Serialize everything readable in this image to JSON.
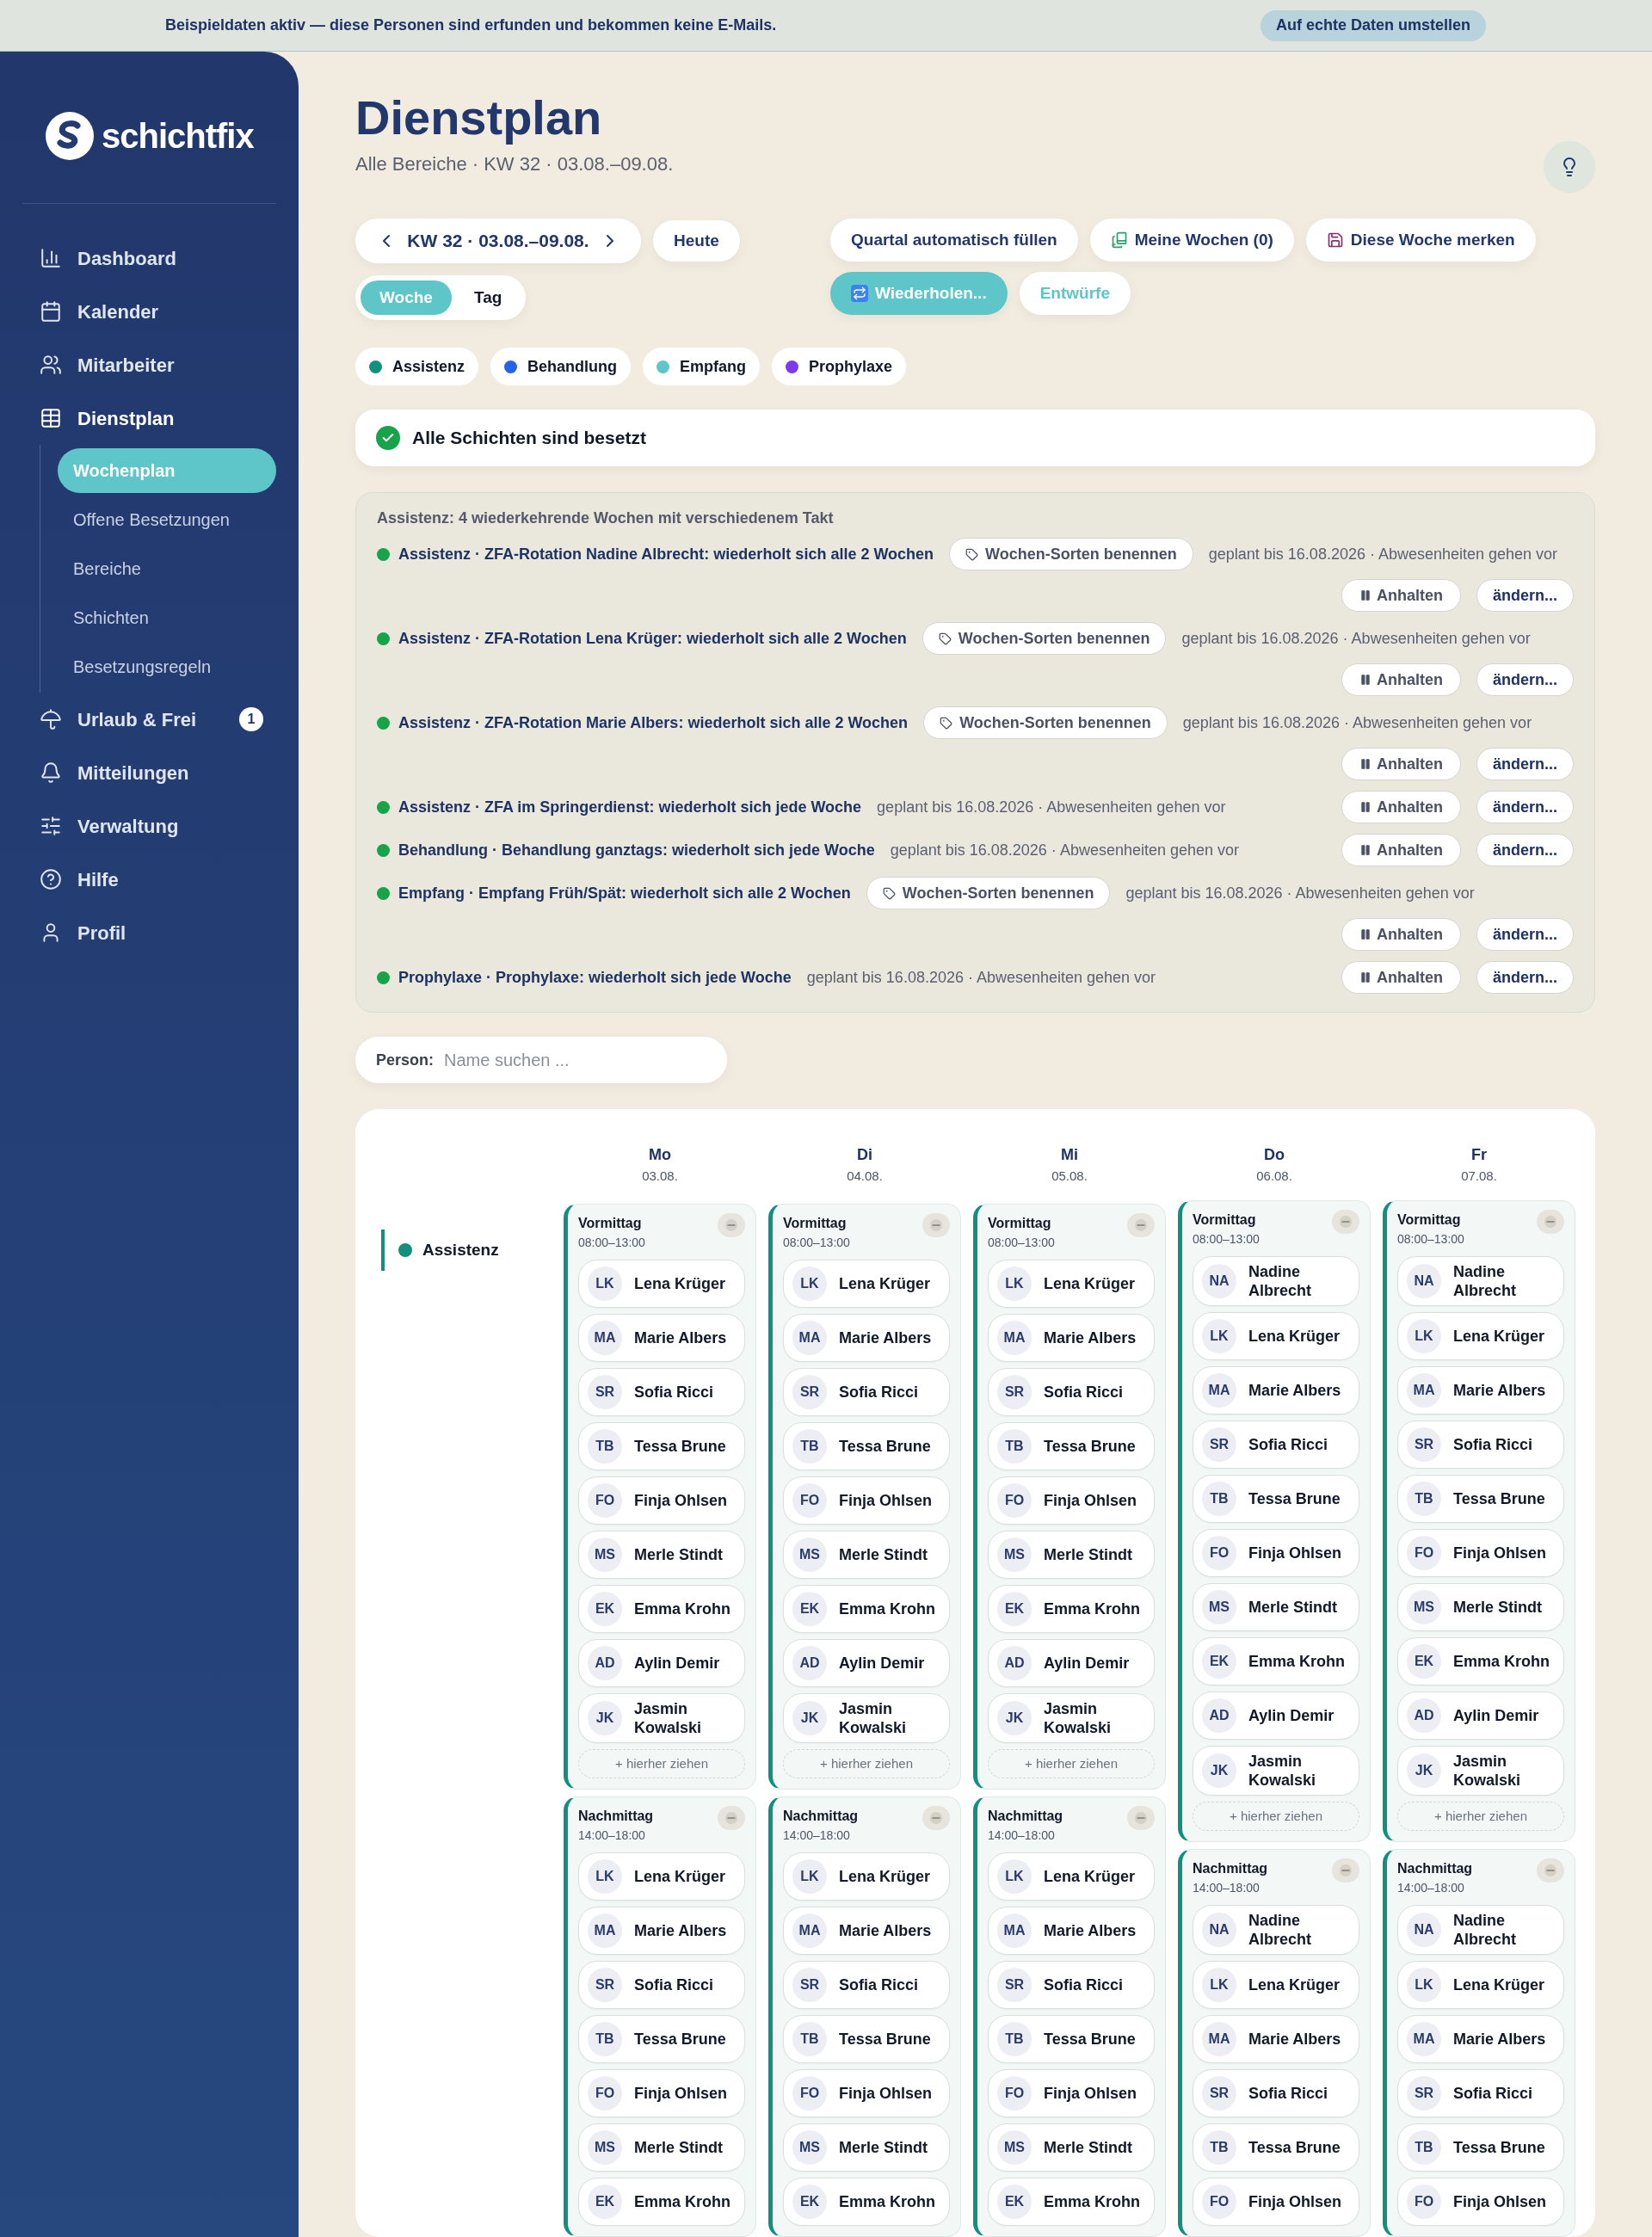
{
  "banner": {
    "text": "Beispieldaten aktiv — diese Personen sind erfunden und bekommen keine E-Mails.",
    "button": "Auf echte Daten umstellen"
  },
  "sidebar": {
    "logo": "schichtfix",
    "items": [
      {
        "label": "Dashboard",
        "selected": false
      },
      {
        "label": "Kalender",
        "selected": false
      },
      {
        "label": "Mitarbeiter",
        "selected": false
      },
      {
        "label": "Dienstplan",
        "selected": true,
        "children": [
          {
            "label": "Wochenplan",
            "selected": true
          },
          {
            "label": "Offene Besetzungen",
            "selected": false
          },
          {
            "label": "Bereiche",
            "selected": false
          },
          {
            "label": "Schichten",
            "selected": false
          },
          {
            "label": "Besetzungsregeln",
            "selected": false
          }
        ]
      },
      {
        "label": "Urlaub & Frei",
        "selected": false,
        "badge": "1"
      },
      {
        "label": "Mitteilungen",
        "selected": false
      },
      {
        "label": "Verwaltung",
        "selected": false
      },
      {
        "label": "Hilfe",
        "selected": false
      },
      {
        "label": "Profil",
        "selected": false
      }
    ]
  },
  "header": {
    "title": "Dienstplan",
    "subtitle": "Alle Bereiche · KW 32 · 03.08.–09.08."
  },
  "week_nav": {
    "label": "KW 32 · 03.08.–09.08.",
    "today": "Heute"
  },
  "view_toggle": [
    {
      "label": "Woche",
      "selected": true
    },
    {
      "label": "Tag",
      "selected": false
    }
  ],
  "actions": [
    {
      "label": "Quartal automatisch füllen",
      "kind": "plain",
      "active": false
    },
    {
      "label": "Meine Wochen (0)",
      "kind": "books",
      "active": false
    },
    {
      "label": "Diese Woche merken",
      "kind": "save",
      "active": false
    },
    {
      "label": "Wiederholen...",
      "kind": "repeat",
      "active": true
    },
    {
      "label": "Entwürfe",
      "kind": "accent",
      "active": false
    }
  ],
  "legend": [
    {
      "label": "Assistenz",
      "color": "#12907f"
    },
    {
      "label": "Behandlung",
      "color": "#2563eb"
    },
    {
      "label": "Empfang",
      "color": "#5ec6c8"
    },
    {
      "label": "Prophylaxe",
      "color": "#7c3aed"
    }
  ],
  "status": {
    "text": "Alle Schichten sind besetzt",
    "ok": true
  },
  "recurrences": {
    "title": "Assistenz: 4 wiederkehrende Wochen mit verschiedenem Takt",
    "items": [
      {
        "title": "Assistenz · ZFA-Rotation Nadine Albrecht: wiederholt sich alle 2 Wochen",
        "name_button": "Wochen-Sorten benennen",
        "note": "geplant bis 16.08.2026 · Abwesenheiten gehen vor",
        "pause": "Anhalten",
        "edit": "ändern..."
      },
      {
        "title": "Assistenz · ZFA-Rotation Lena Krüger: wiederholt sich alle 2 Wochen",
        "name_button": "Wochen-Sorten benennen",
        "note": "geplant bis 16.08.2026 · Abwesenheiten gehen vor",
        "pause": "Anhalten",
        "edit": "ändern..."
      },
      {
        "title": "Assistenz · ZFA-Rotation Marie Albers: wiederholt sich alle 2 Wochen",
        "name_button": "Wochen-Sorten benennen",
        "note": "geplant bis 16.08.2026 · Abwesenheiten gehen vor",
        "pause": "Anhalten",
        "edit": "ändern..."
      },
      {
        "title": "Assistenz · ZFA im Springerdienst: wiederholt sich jede Woche",
        "note": "geplant bis 16.08.2026 · Abwesenheiten gehen vor",
        "pause": "Anhalten",
        "edit": "ändern..."
      },
      {
        "title": "Behandlung · Behandlung ganztags: wiederholt sich jede Woche",
        "note": "geplant bis 16.08.2026 · Abwesenheiten gehen vor",
        "pause": "Anhalten",
        "edit": "ändern..."
      },
      {
        "title": "Empfang · Empfang Früh/Spät: wiederholt sich alle 2 Wochen",
        "name_button": "Wochen-Sorten benennen",
        "note": "geplant bis 16.08.2026 · Abwesenheiten gehen vor",
        "pause": "Anhalten",
        "edit": "ändern..."
      },
      {
        "title": "Prophylaxe · Prophylaxe: wiederholt sich jede Woche",
        "note": "geplant bis 16.08.2026 · Abwesenheiten gehen vor",
        "pause": "Anhalten",
        "edit": "ändern..."
      }
    ]
  },
  "search": {
    "label": "Person:",
    "placeholder": "Name suchen ..."
  },
  "schedule": {
    "days": [
      {
        "name": "Mo",
        "date": "03.08."
      },
      {
        "name": "Di",
        "date": "04.08."
      },
      {
        "name": "Mi",
        "date": "05.08."
      },
      {
        "name": "Do",
        "date": "06.08."
      },
      {
        "name": "Fr",
        "date": "07.08."
      }
    ],
    "area": {
      "name": "Assistenz",
      "color": "#12907f"
    },
    "columns": [
      {
        "shifts": [
          {
            "name": "Vormittag",
            "time": "08:00–13:00",
            "people": [
              [
                "LK",
                "Lena Krüger"
              ],
              [
                "MA",
                "Marie Albers"
              ],
              [
                "SR",
                "Sofia Ricci"
              ],
              [
                "TB",
                "Tessa Brune"
              ],
              [
                "FO",
                "Finja Ohlsen"
              ],
              [
                "MS",
                "Merle Stindt"
              ],
              [
                "EK",
                "Emma Krohn"
              ],
              [
                "AD",
                "Aylin Demir"
              ],
              [
                "JK",
                "Jasmin Kowalski"
              ]
            ],
            "drop_hint": "+ hierher ziehen"
          },
          {
            "name": "Nachmittag",
            "time": "14:00–18:00",
            "people": [
              [
                "LK",
                "Lena Krüger"
              ],
              [
                "MA",
                "Marie Albers"
              ],
              [
                "SR",
                "Sofia Ricci"
              ],
              [
                "TB",
                "Tessa Brune"
              ],
              [
                "FO",
                "Finja Ohlsen"
              ],
              [
                "MS",
                "Merle Stindt"
              ],
              [
                "EK",
                "Emma Krohn"
              ]
            ]
          }
        ]
      },
      {
        "shifts": [
          {
            "name": "Vormittag",
            "time": "08:00–13:00",
            "people": [
              [
                "LK",
                "Lena Krüger"
              ],
              [
                "MA",
                "Marie Albers"
              ],
              [
                "SR",
                "Sofia Ricci"
              ],
              [
                "TB",
                "Tessa Brune"
              ],
              [
                "FO",
                "Finja Ohlsen"
              ],
              [
                "MS",
                "Merle Stindt"
              ],
              [
                "EK",
                "Emma Krohn"
              ],
              [
                "AD",
                "Aylin Demir"
              ],
              [
                "JK",
                "Jasmin Kowalski"
              ]
            ],
            "drop_hint": "+ hierher ziehen"
          },
          {
            "name": "Nachmittag",
            "time": "14:00–18:00",
            "people": [
              [
                "LK",
                "Lena Krüger"
              ],
              [
                "MA",
                "Marie Albers"
              ],
              [
                "SR",
                "Sofia Ricci"
              ],
              [
                "TB",
                "Tessa Brune"
              ],
              [
                "FO",
                "Finja Ohlsen"
              ],
              [
                "MS",
                "Merle Stindt"
              ],
              [
                "EK",
                "Emma Krohn"
              ]
            ]
          }
        ]
      },
      {
        "shifts": [
          {
            "name": "Vormittag",
            "time": "08:00–13:00",
            "people": [
              [
                "LK",
                "Lena Krüger"
              ],
              [
                "MA",
                "Marie Albers"
              ],
              [
                "SR",
                "Sofia Ricci"
              ],
              [
                "TB",
                "Tessa Brune"
              ],
              [
                "FO",
                "Finja Ohlsen"
              ],
              [
                "MS",
                "Merle Stindt"
              ],
              [
                "EK",
                "Emma Krohn"
              ],
              [
                "AD",
                "Aylin Demir"
              ],
              [
                "JK",
                "Jasmin Kowalski"
              ]
            ],
            "drop_hint": "+ hierher ziehen"
          },
          {
            "name": "Nachmittag",
            "time": "14:00–18:00",
            "people": [
              [
                "LK",
                "Lena Krüger"
              ],
              [
                "MA",
                "Marie Albers"
              ],
              [
                "SR",
                "Sofia Ricci"
              ],
              [
                "TB",
                "Tessa Brune"
              ],
              [
                "FO",
                "Finja Ohlsen"
              ],
              [
                "MS",
                "Merle Stindt"
              ],
              [
                "EK",
                "Emma Krohn"
              ]
            ]
          }
        ]
      },
      {
        "shifts": [
          {
            "name": "Vormittag",
            "time": "08:00–13:00",
            "people": [
              [
                "NA",
                "Nadine Albrecht"
              ],
              [
                "LK",
                "Lena Krüger"
              ],
              [
                "MA",
                "Marie Albers"
              ],
              [
                "SR",
                "Sofia Ricci"
              ],
              [
                "TB",
                "Tessa Brune"
              ],
              [
                "FO",
                "Finja Ohlsen"
              ],
              [
                "MS",
                "Merle Stindt"
              ],
              [
                "EK",
                "Emma Krohn"
              ],
              [
                "AD",
                "Aylin Demir"
              ],
              [
                "JK",
                "Jasmin Kowalski"
              ]
            ],
            "drop_hint": "+ hierher ziehen"
          },
          {
            "name": "Nachmittag",
            "time": "14:00–18:00",
            "people": [
              [
                "NA",
                "Nadine Albrecht"
              ],
              [
                "LK",
                "Lena Krüger"
              ],
              [
                "MA",
                "Marie Albers"
              ],
              [
                "SR",
                "Sofia Ricci"
              ],
              [
                "TB",
                "Tessa Brune"
              ],
              [
                "FO",
                "Finja Ohlsen"
              ]
            ]
          }
        ]
      },
      {
        "shifts": [
          {
            "name": "Vormittag",
            "time": "08:00–13:00",
            "people": [
              [
                "NA",
                "Nadine Albrecht"
              ],
              [
                "LK",
                "Lena Krüger"
              ],
              [
                "MA",
                "Marie Albers"
              ],
              [
                "SR",
                "Sofia Ricci"
              ],
              [
                "TB",
                "Tessa Brune"
              ],
              [
                "FO",
                "Finja Ohlsen"
              ],
              [
                "MS",
                "Merle Stindt"
              ],
              [
                "EK",
                "Emma Krohn"
              ],
              [
                "AD",
                "Aylin Demir"
              ],
              [
                "JK",
                "Jasmin Kowalski"
              ]
            ],
            "drop_hint": "+ hierher ziehen"
          },
          {
            "name": "Nachmittag",
            "time": "14:00–18:00",
            "people": [
              [
                "NA",
                "Nadine Albrecht"
              ],
              [
                "LK",
                "Lena Krüger"
              ],
              [
                "MA",
                "Marie Albers"
              ],
              [
                "SR",
                "Sofia Ricci"
              ],
              [
                "TB",
                "Tessa Brune"
              ],
              [
                "FO",
                "Finja Ohlsen"
              ]
            ]
          }
        ]
      }
    ]
  }
}
